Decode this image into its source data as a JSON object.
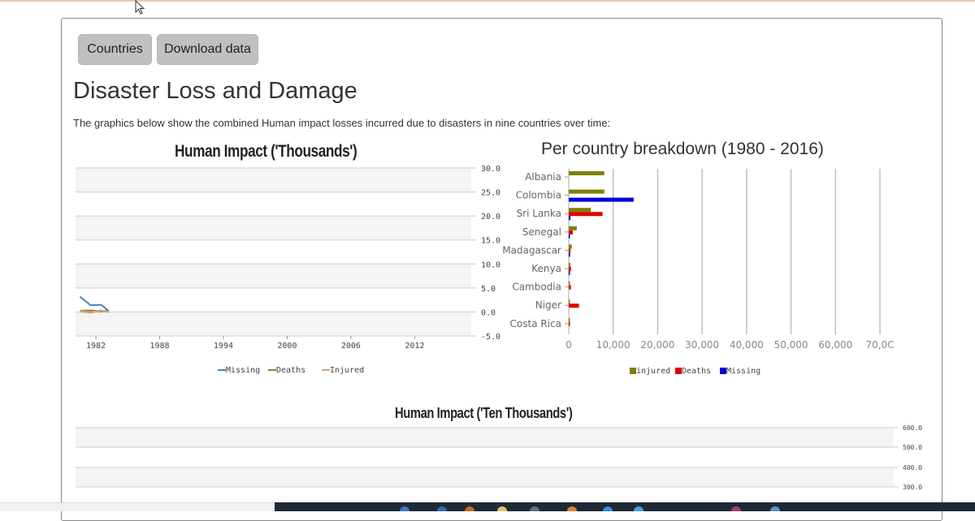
{
  "buttons": {
    "countries": "Countries",
    "download": "Download data"
  },
  "page": {
    "title": "Disaster Loss and Damage",
    "description": "The graphics below show the combined Human impact losses incurred due to disasters in nine countries over time:"
  },
  "colors": {
    "missing": "#4a7fc0",
    "deaths": "#a0783c",
    "injured": "#c8aa78",
    "bar_injured": "#808000",
    "bar_deaths": "#e00000",
    "bar_missing": "#0000e0",
    "band": "#f4f4f4"
  },
  "chart_data": [
    {
      "type": "line",
      "title": "Human Impact  ('Thousands')",
      "x_ticks": [
        "1982",
        "1988",
        "1994",
        "2000",
        "2006",
        "2012"
      ],
      "y_ticks": [
        "30.0",
        "25.0",
        "20.0",
        "15.0",
        "10.0",
        "5.0",
        "0.0",
        "-5.0"
      ],
      "ylim": [
        -5,
        30
      ],
      "xlim": [
        1980.3,
        2016.8
      ],
      "legend": [
        "Missing",
        "Deaths",
        "Injured"
      ],
      "series": [
        {
          "name": "Missing",
          "x": [
            1980.5,
            1981.5,
            1982.5,
            1983.2
          ],
          "y": [
            3.2,
            1.4,
            1.5,
            0.2
          ]
        },
        {
          "name": "Deaths",
          "x": [
            1980.5,
            1981.5,
            1982.5,
            1983.2
          ],
          "y": [
            0.2,
            0.3,
            0.1,
            0.3
          ]
        },
        {
          "name": "Injured",
          "x": [
            1980.5,
            1981.5,
            1982.5,
            1983.2
          ],
          "y": [
            0.1,
            -0.1,
            0.3,
            0.0
          ]
        }
      ]
    },
    {
      "type": "bar",
      "orientation": "horizontal",
      "title": "Per country breakdown (1980 - 2016)",
      "categories": [
        "Albania",
        "Colombia",
        "Sri Lanka",
        "Senegal",
        "Madagascar",
        "Kenya",
        "Cambodia",
        "Niger",
        "Costa Rica"
      ],
      "x_ticks": [
        "0",
        "10,000",
        "20,000",
        "30,000",
        "40,000",
        "50,000",
        "60,000",
        "70,0C"
      ],
      "xlim": [
        0,
        70000
      ],
      "legend": [
        "injured",
        "Deaths",
        "Missing"
      ],
      "series": [
        {
          "name": "injured",
          "values": [
            8000,
            8000,
            5000,
            1800,
            700,
            400,
            200,
            200,
            100
          ]
        },
        {
          "name": "Deaths",
          "values": [
            0,
            0,
            7600,
            900,
            400,
            500,
            500,
            2300,
            200
          ]
        },
        {
          "name": "Missing",
          "values": [
            0,
            14600,
            400,
            100,
            300,
            100,
            0,
            0,
            0
          ]
        }
      ]
    },
    {
      "type": "line",
      "title": "Human Impact  ('Ten Thousands')",
      "y_ticks": [
        "600.0",
        "500.0",
        "400.0",
        "300.0"
      ]
    }
  ]
}
